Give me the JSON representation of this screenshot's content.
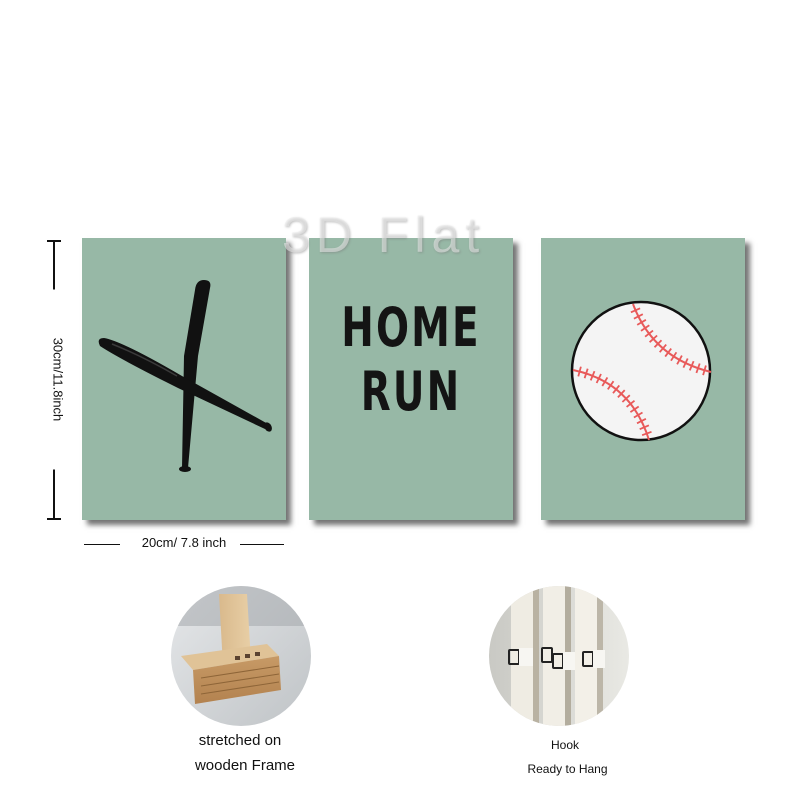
{
  "watermark": {
    "text": "3D Flat"
  },
  "panels": {
    "left": {
      "icon": "crossed-baseball-bats-icon",
      "color": "#97b8a6"
    },
    "middle": {
      "line1": "HOME",
      "line2": "RUN",
      "text_color": "#141414",
      "color": "#97b8a6"
    },
    "right": {
      "icon": "baseball-icon",
      "stitch_color": "#e85a5a",
      "color": "#97b8a6"
    }
  },
  "dimensions": {
    "height_label": "30cm/11.8inch",
    "width_label": "20cm/ 7.8 inch"
  },
  "features": {
    "frame": {
      "icon": "wooden-frame-photo",
      "caption_line1": "stretched on",
      "caption_line2": "wooden Frame"
    },
    "hook": {
      "icon": "hanging-hook-photo",
      "caption_line1": "Hook",
      "caption_line2": "Ready to Hang"
    }
  }
}
